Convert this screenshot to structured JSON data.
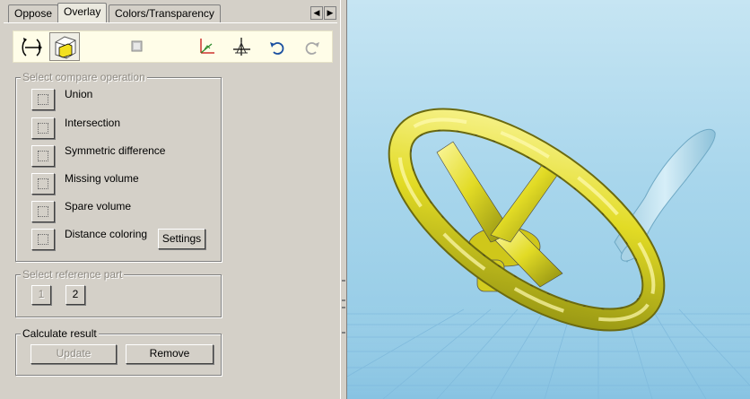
{
  "tabs": [
    {
      "label": "Oppose",
      "active": false
    },
    {
      "label": "Overlay",
      "active": true
    },
    {
      "label": "Colors/Transparency",
      "active": false
    }
  ],
  "toolbar": {
    "icons": [
      "rotate-view-icon",
      "overlay-box-icon",
      "stop-icon",
      "axis-system-icon",
      "compass-icon",
      "undo-icon",
      "redo-icon"
    ]
  },
  "compare_group": {
    "title": "Select compare operation",
    "operations": [
      {
        "label": "Union"
      },
      {
        "label": "Intersection"
      },
      {
        "label": "Symmetric difference"
      },
      {
        "label": "Missing volume"
      },
      {
        "label": "Spare volume"
      },
      {
        "label": "Distance coloring"
      }
    ],
    "settings_label": "Settings"
  },
  "reference_group": {
    "title": "Select reference part",
    "part_buttons": [
      "1",
      "2"
    ]
  },
  "calculate_group": {
    "title": "Calculate result",
    "update_label": "Update",
    "remove_label": "Remove"
  },
  "colors": {
    "panel_bg": "#d4d0c8",
    "toolbar_bg": "#fffde8",
    "viewport_top": "#c6e5f3",
    "viewport_bottom": "#8fc8e4",
    "wheel_yellow": "#e6e22a",
    "handle_glass": "#b8dcea"
  }
}
